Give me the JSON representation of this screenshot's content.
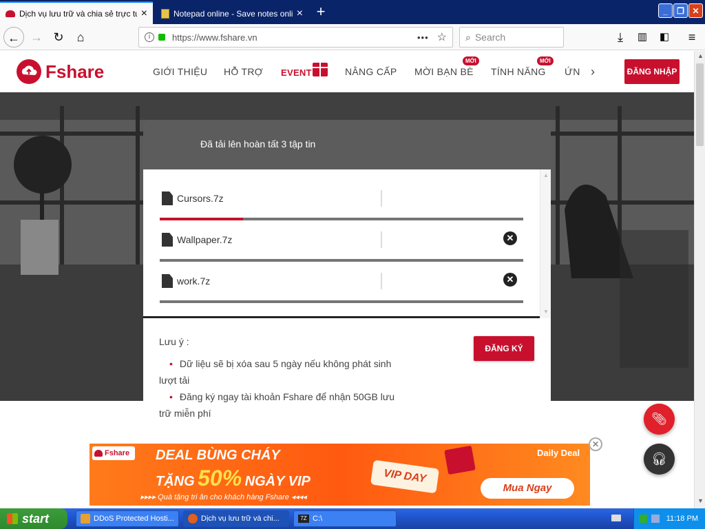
{
  "browser": {
    "tabs": [
      {
        "title": "Dịch vụ lưu trữ và chia sẻ trực tuyế",
        "active": true
      },
      {
        "title": "Notepad online - Save notes online",
        "active": false
      }
    ],
    "url": "https://www.fshare.vn",
    "search_placeholder": "Search"
  },
  "site": {
    "logo": "Fshare",
    "menu": [
      "GIỚI THIỆU",
      "HỖ TRỢ",
      "EVENT",
      "NÂNG CẤP",
      "MỜI BẠN BÈ",
      "TÍNH NĂNG",
      "ỨN"
    ],
    "new_badge": "MỚI",
    "login": "ĐĂNG NHẬP"
  },
  "upload": {
    "title": "Đã tải lên hoàn tất 3 tập tin",
    "files": [
      {
        "name": "Cursors.7z",
        "progress": 0.23
      },
      {
        "name": "Wallpaper.7z",
        "progress": 0
      },
      {
        "name": "work.7z",
        "progress": 0
      }
    ],
    "note_label": "Lưu ý :",
    "note1_a": "Dữ liệu sẽ bị xóa sau 5 ngày nếu không phát sinh",
    "note1_b": "lượt tải",
    "note2_a": "Đăng ký ngay tài khoản Fshare để nhận 50GB lưu",
    "note2_b": "trữ miễn phí",
    "register": "ĐĂNG KÝ"
  },
  "banner": {
    "logo": "Fshare",
    "headline": "DEAL BÙNG CHÁY",
    "offer_prefix": "TẶNG",
    "offer_value": "50%",
    "offer_suffix": "NGÀY VIP",
    "subline": "▸▸▸▸ Quà tặng tri ân cho khách hàng Fshare ◂◂◂◂",
    "tag": "VIP DAY",
    "daily": "Daily Deal",
    "cta": "Mua Ngay"
  },
  "taskbar": {
    "start": "start",
    "tasks": [
      "DDoS Protected Hosti...",
      "Dịch vụ lưu trữ và chi...",
      "C:\\"
    ],
    "clock": "11:18 PM"
  },
  "colors": {
    "brand": "#c8102e",
    "titlebar": "#0a246a",
    "taskbar": "#245edb"
  }
}
